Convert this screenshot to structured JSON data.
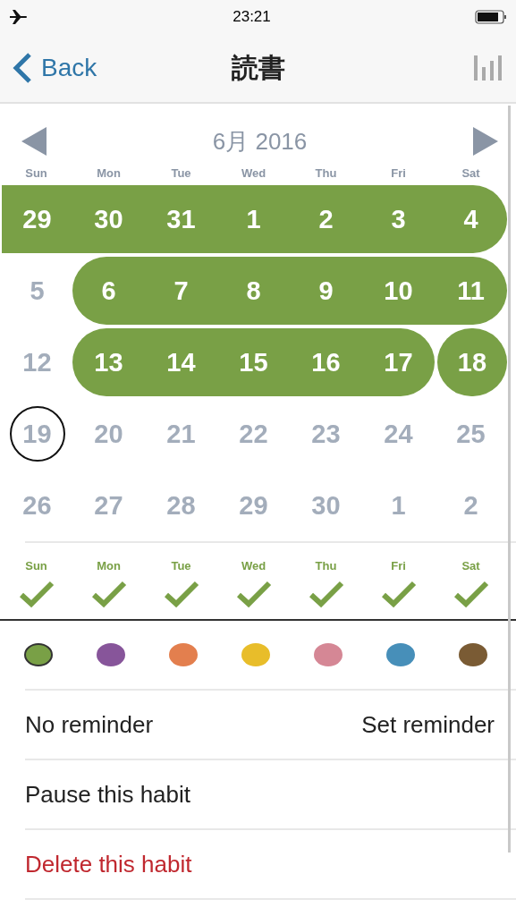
{
  "status_bar": {
    "time": "23:21"
  },
  "nav": {
    "back": "Back",
    "title": "読書"
  },
  "calendar": {
    "month": "6月 2016",
    "weekdays": [
      "Sun",
      "Mon",
      "Tue",
      "Wed",
      "Thu",
      "Fri",
      "Sat"
    ],
    "weeks": [
      [
        {
          "day": "29",
          "done": true,
          "new_streak": false,
          "today": false
        },
        {
          "day": "30",
          "done": true,
          "new_streak": false,
          "today": false
        },
        {
          "day": "31",
          "done": true,
          "new_streak": false,
          "today": false
        },
        {
          "day": "1",
          "done": true,
          "new_streak": false,
          "today": false
        },
        {
          "day": "2",
          "done": true,
          "new_streak": false,
          "today": false
        },
        {
          "day": "3",
          "done": true,
          "new_streak": false,
          "today": false
        },
        {
          "day": "4",
          "done": true,
          "new_streak": false,
          "today": false
        }
      ],
      [
        {
          "day": "5",
          "done": false,
          "today": false
        },
        {
          "day": "6",
          "done": true,
          "new_streak": false,
          "today": false
        },
        {
          "day": "7",
          "done": true,
          "new_streak": false,
          "today": false
        },
        {
          "day": "8",
          "done": true,
          "new_streak": false,
          "today": false
        },
        {
          "day": "9",
          "done": true,
          "new_streak": false,
          "today": false
        },
        {
          "day": "10",
          "done": true,
          "new_streak": false,
          "today": false
        },
        {
          "day": "11",
          "done": true,
          "new_streak": false,
          "today": false
        }
      ],
      [
        {
          "day": "12",
          "done": false,
          "today": false
        },
        {
          "day": "13",
          "done": true,
          "new_streak": false,
          "today": false
        },
        {
          "day": "14",
          "done": true,
          "new_streak": false,
          "today": false
        },
        {
          "day": "15",
          "done": true,
          "new_streak": false,
          "today": false
        },
        {
          "day": "16",
          "done": true,
          "new_streak": false,
          "today": false
        },
        {
          "day": "17",
          "done": true,
          "new_streak": false,
          "today": false
        },
        {
          "day": "18",
          "done": true,
          "new_streak": true,
          "today": false
        }
      ],
      [
        {
          "day": "19",
          "done": false,
          "today": true
        },
        {
          "day": "20",
          "done": false,
          "today": false
        },
        {
          "day": "21",
          "done": false,
          "today": false
        },
        {
          "day": "22",
          "done": false,
          "today": false
        },
        {
          "day": "23",
          "done": false,
          "today": false
        },
        {
          "day": "24",
          "done": false,
          "today": false
        },
        {
          "day": "25",
          "done": false,
          "today": false
        }
      ],
      [
        {
          "day": "26",
          "done": false,
          "today": false
        },
        {
          "day": "27",
          "done": false,
          "today": false
        },
        {
          "day": "28",
          "done": false,
          "today": false
        },
        {
          "day": "29",
          "done": false,
          "today": false
        },
        {
          "day": "30",
          "done": false,
          "today": false
        },
        {
          "day": "1",
          "done": false,
          "today": false
        },
        {
          "day": "2",
          "done": false,
          "today": false
        }
      ]
    ]
  },
  "schedule": [
    {
      "label": "Sun",
      "checked": true
    },
    {
      "label": "Mon",
      "checked": true
    },
    {
      "label": "Tue",
      "checked": true
    },
    {
      "label": "Wed",
      "checked": true
    },
    {
      "label": "Thu",
      "checked": true
    },
    {
      "label": "Fri",
      "checked": true
    },
    {
      "label": "Sat",
      "checked": true
    }
  ],
  "colors": [
    {
      "color": "#79a046",
      "selected": true
    },
    {
      "color": "#87559a",
      "selected": false
    },
    {
      "color": "#e37f4e",
      "selected": false
    },
    {
      "color": "#e8bd2a",
      "selected": false
    },
    {
      "color": "#d58795",
      "selected": false
    },
    {
      "color": "#478fb9",
      "selected": false
    },
    {
      "color": "#7a5b34",
      "selected": false
    }
  ],
  "reminder": {
    "status": "No reminder",
    "action": "Set reminder"
  },
  "actions": [
    {
      "label": "Pause this habit",
      "kind": "normal"
    },
    {
      "label": "Delete this habit",
      "kind": "destructive"
    }
  ]
}
